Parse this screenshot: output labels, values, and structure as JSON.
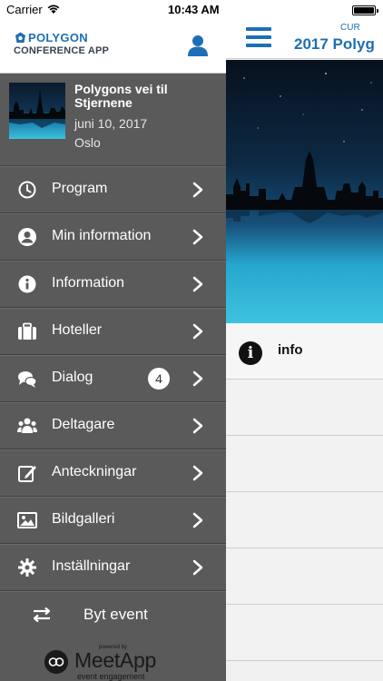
{
  "status_bar": {
    "carrier": "Carrier",
    "time": "10:43 AM"
  },
  "app": {
    "brand": "POLYGON",
    "subtitle": "CONFERENCE APP"
  },
  "event": {
    "title": "Polygons vei til Stjernene",
    "date": "juni 10, 2017",
    "city": "Oslo"
  },
  "menu": {
    "items": [
      {
        "label": "Program",
        "icon": "clock-icon"
      },
      {
        "label": "Min information",
        "icon": "user-circle-icon"
      },
      {
        "label": "Information",
        "icon": "info-icon"
      },
      {
        "label": "Hoteller",
        "icon": "suitcase-icon"
      },
      {
        "label": "Dialog",
        "icon": "chat-bubbles-icon",
        "badge": "4"
      },
      {
        "label": "Deltagare",
        "icon": "people-icon"
      },
      {
        "label": "Anteckningar",
        "icon": "edit-note-icon"
      },
      {
        "label": "Bildgalleri",
        "icon": "image-icon"
      },
      {
        "label": "Inställningar",
        "icon": "gear-icon"
      }
    ]
  },
  "switch_event": {
    "label": "Byt event"
  },
  "footer": {
    "powered": "powered by",
    "name": "MeetApp",
    "tagline": "event engagement"
  },
  "main": {
    "sup_title": "CUR",
    "title": "2017 Polyg",
    "rows": [
      {
        "label": "info",
        "icon": "info-icon"
      }
    ]
  },
  "colors": {
    "accent": "#1d6fb5",
    "drawer_bg": "#5a5a5a",
    "badge_bg": "#ffffff"
  }
}
